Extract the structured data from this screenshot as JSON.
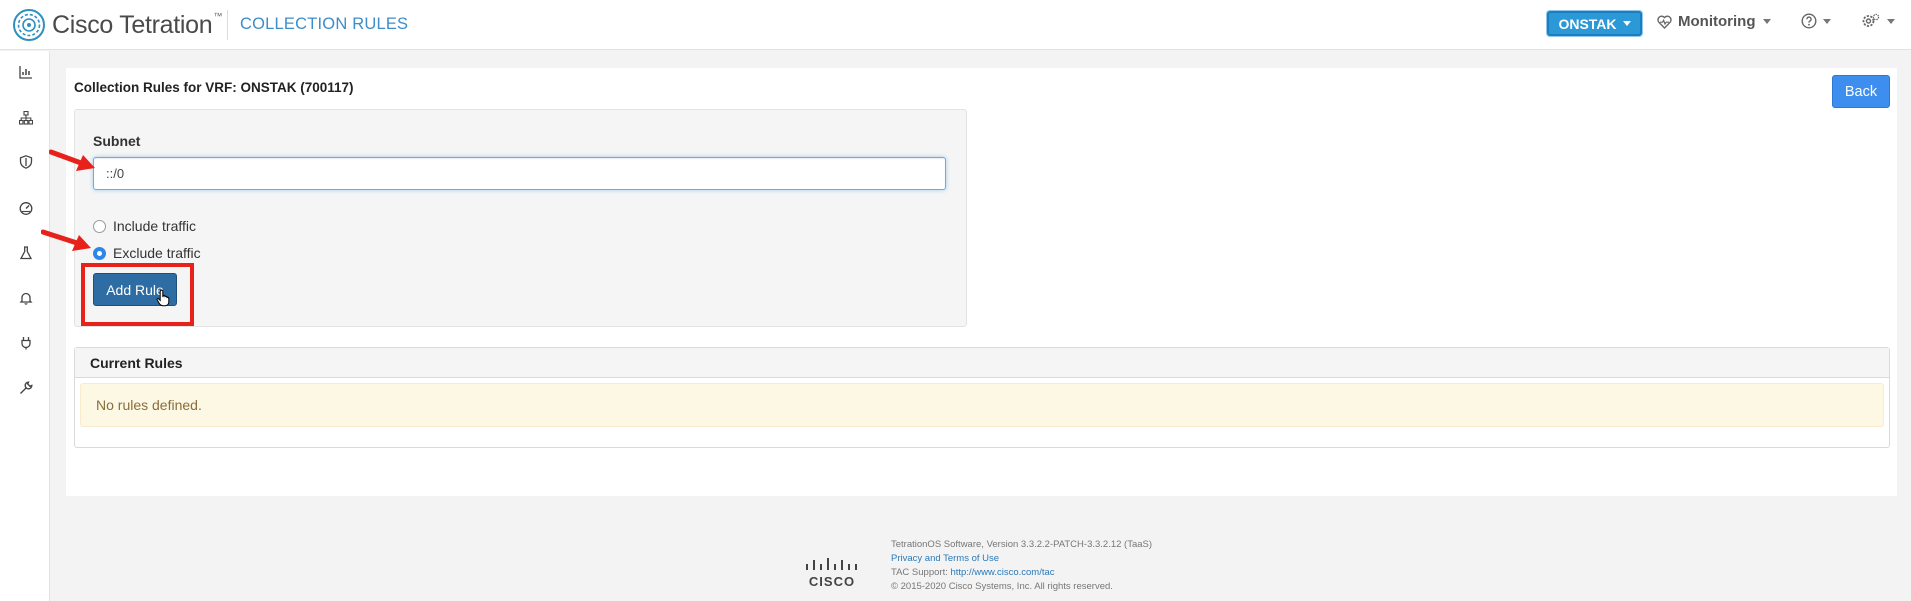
{
  "app": {
    "brand": "Cisco Tetration",
    "page_heading": "COLLECTION RULES"
  },
  "topbar": {
    "vrf_selector": "ONSTAK",
    "monitoring_label": "Monitoring"
  },
  "sidebar": {
    "icons": [
      "dashboard-icon",
      "topology-icon",
      "security-icon",
      "gauge-icon",
      "flask-icon",
      "alerts-icon",
      "plug-icon",
      "wrench-icon"
    ]
  },
  "card": {
    "title": "Collection Rules for VRF: ONSTAK (700117)",
    "back_label": "Back"
  },
  "form": {
    "subnet_label": "Subnet",
    "subnet_value": "::/0",
    "include_label": "Include traffic",
    "exclude_label": "Exclude traffic",
    "selected_option": "exclude",
    "add_rule_label": "Add Rule"
  },
  "rules": {
    "heading": "Current Rules",
    "empty_message": "No rules defined."
  },
  "footer": {
    "logo_text": "CISCO",
    "software": "TetrationOS Software, Version 3.3.2.2-PATCH-3.3.2.12 (TaaS)",
    "privacy_link": "Privacy and Terms of Use",
    "tac_label": "TAC Support: ",
    "tac_link": "http://www.cisco.com/tac",
    "copyright": "© 2015-2020 Cisco Systems, Inc. All rights reserved."
  },
  "colors": {
    "accent": "#3c8dcb",
    "primary_button": "#2e6da4",
    "back_button": "#3d8eef",
    "annotation_red": "#e8221b"
  }
}
